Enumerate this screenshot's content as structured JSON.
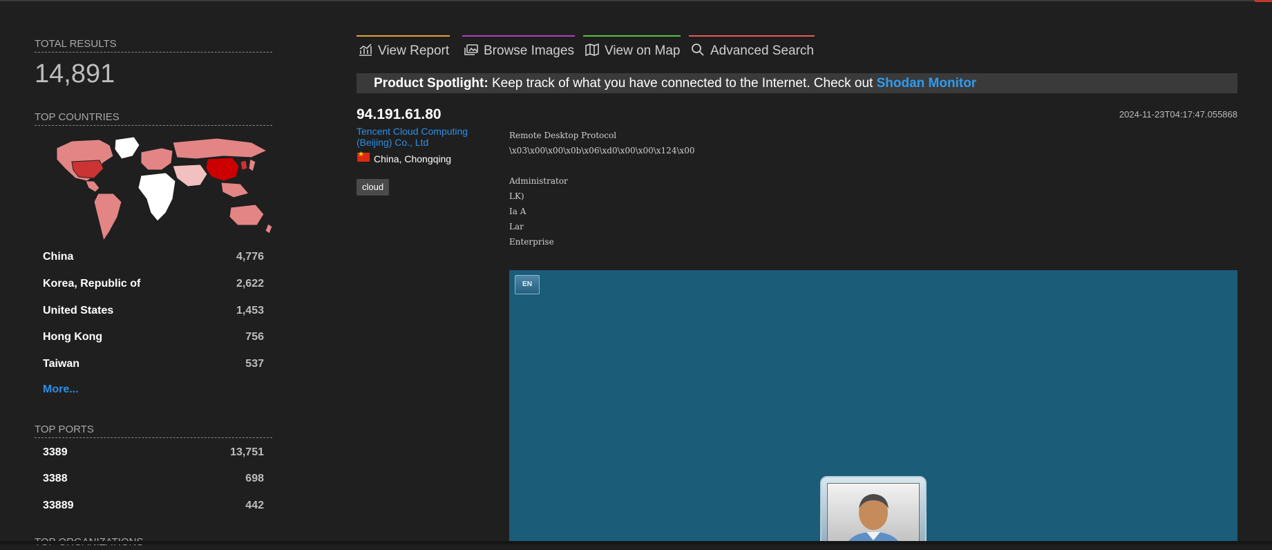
{
  "sidebar": {
    "total_results_title": "TOTAL RESULTS",
    "total_results": "14,891",
    "top_countries_title": "TOP COUNTRIES",
    "countries": [
      {
        "name": "China",
        "count": "4,776"
      },
      {
        "name": "Korea, Republic of",
        "count": "2,622"
      },
      {
        "name": "United States",
        "count": "1,453"
      },
      {
        "name": "Hong Kong",
        "count": "756"
      },
      {
        "name": "Taiwan",
        "count": "537"
      }
    ],
    "more_label": "More...",
    "top_ports_title": "TOP PORTS",
    "ports": [
      {
        "name": "3389",
        "count": "13,751"
      },
      {
        "name": "3388",
        "count": "698"
      },
      {
        "name": "33889",
        "count": "442"
      }
    ],
    "top_orgs_title": "TOP ORGANIZATIONS"
  },
  "tabs": [
    {
      "label": "View Report",
      "icon": "chart-icon",
      "color": "#e8a33c"
    },
    {
      "label": "Browse Images",
      "icon": "images-icon",
      "color": "#b13fc4"
    },
    {
      "label": "View on Map",
      "icon": "map-icon",
      "color": "#5fbf4a"
    },
    {
      "label": "Advanced Search",
      "icon": "search-icon",
      "color": "#e65a5a"
    }
  ],
  "spotlight": {
    "label": "Product Spotlight:",
    "text": "Keep track of what you have connected to the Internet. Check out",
    "link": "Shodan Monitor"
  },
  "result": {
    "ip": "94.191.61.80",
    "org": "Tencent Cloud Computing (Beijing) Co., Ltd",
    "location": "China, Chongqing",
    "tag": "cloud",
    "timestamp": "2024-11-23T04:17:47.055868",
    "banner": [
      "Remote Desktop Protocol",
      "\\x03\\x00\\x00\\x0b\\x06\\xd0\\x00\\x00\\x124\\x00",
      "",
      "Administrator",
      "LK)",
      "Ia A",
      "Lar",
      "Enterprise"
    ],
    "screenshot_lang": "EN"
  },
  "colors": {
    "background": "#1f1f1f",
    "link": "#2e8fe6",
    "map_high": "#cc0000",
    "map_medium": "#e38585",
    "map_low": "#ffffff"
  }
}
